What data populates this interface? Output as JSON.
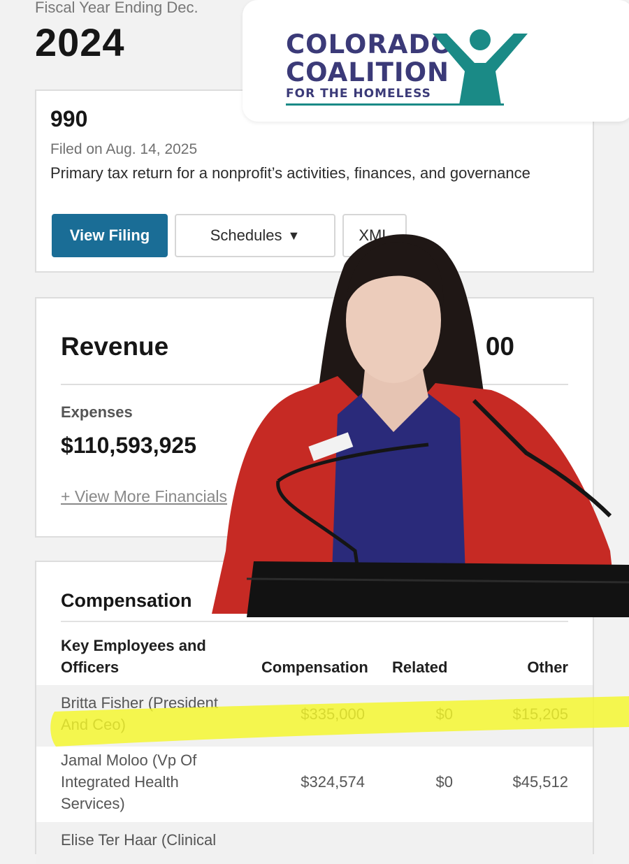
{
  "header": {
    "fiscal_label": "Fiscal Year Ending Dec.",
    "year": "2024"
  },
  "filing": {
    "form": "990",
    "filed_on": "Filed on Aug. 14, 2025",
    "description": "Primary tax return for a nonprofit’s activities, finances, and governance",
    "buttons": {
      "view": "View Filing",
      "schedules": "Schedules",
      "schedules_caret": "▼",
      "xml": "XML"
    }
  },
  "financials": {
    "revenue_label": "Revenue",
    "revenue_value_visible": "00",
    "expenses_label": "Expenses",
    "expenses_value": "$110,593,925",
    "more_link": "+ View More Financials"
  },
  "compensation": {
    "title": "Compensation",
    "headers": {
      "name_line1": "Key Employees and",
      "name_line2": "Officers",
      "comp": "Compensation",
      "related": "Related",
      "other": "Other"
    },
    "rows": [
      {
        "name1": "Britta Fisher (President",
        "name2": "And Ceo)",
        "name3": "",
        "comp": "$335,000",
        "related": "$0",
        "other": "$15,205"
      },
      {
        "name1": "Jamal Moloo (Vp Of",
        "name2": "Integrated Health",
        "name3": "Services)",
        "comp": "$324,574",
        "related": "$0",
        "other": "$45,512"
      },
      {
        "name1": "Elise Ter Haar (Clinical",
        "name2": "",
        "name3": "",
        "comp": "",
        "related": "",
        "other": ""
      }
    ]
  },
  "logo": {
    "line1": "COLORADO",
    "line2": "COALITION",
    "line3": "FOR THE HOMELESS",
    "brand_color": "#3b3a78",
    "accent_color": "#1a8a86"
  },
  "overlay": {
    "highlight_color": "#f4f72a",
    "jacket_color": "#c62a24",
    "top_color": "#2a2a7a"
  }
}
